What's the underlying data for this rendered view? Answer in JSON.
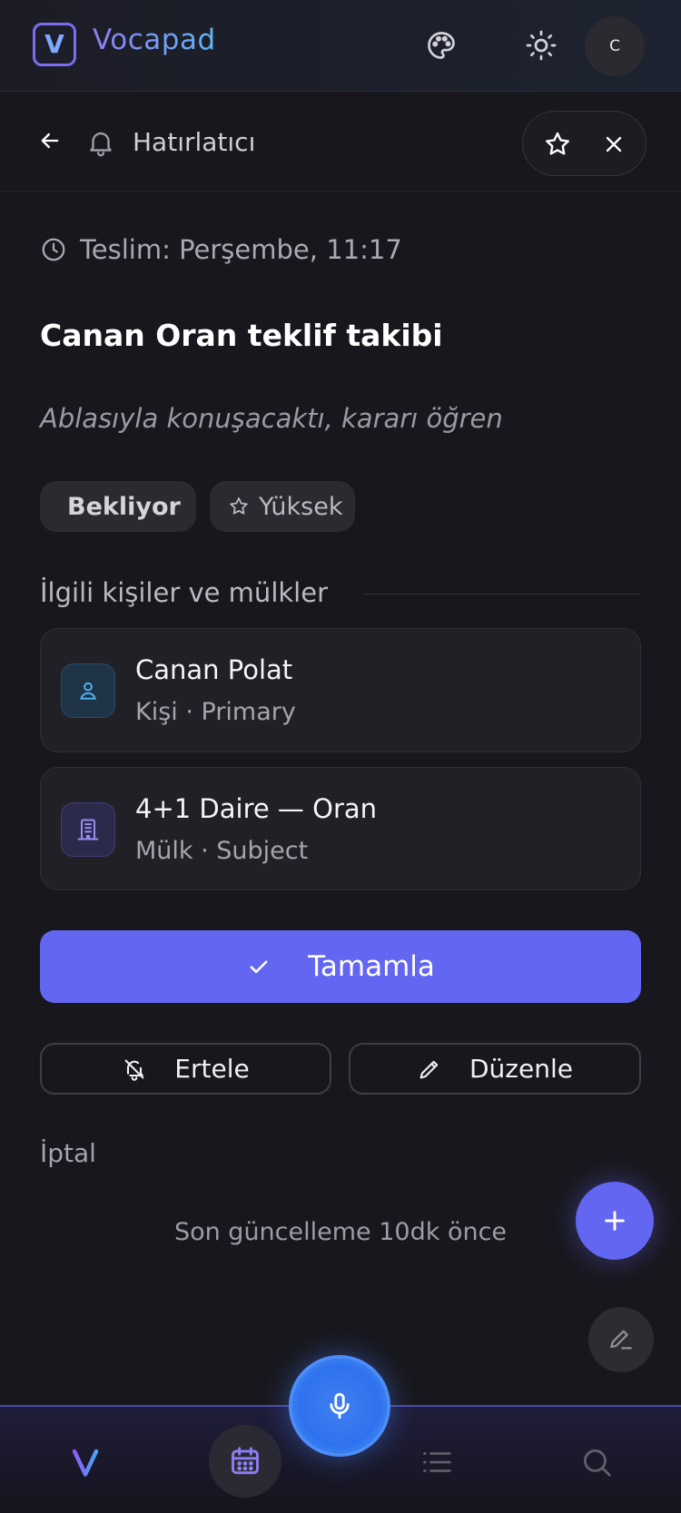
{
  "header": {
    "logo_letter": "V",
    "brand": "Vocapad",
    "avatar_initial": "C",
    "icons": [
      "palette-icon",
      "sun-icon"
    ]
  },
  "subheader": {
    "title": "Hatırlatıcı",
    "icons": [
      "back-arrow-icon",
      "bell-icon",
      "star-icon",
      "close-icon"
    ]
  },
  "reminder": {
    "due": "Teslim: Perşembe, 11:17",
    "title": "Canan Oran teklif takibi",
    "note": "Ablasıyla konuşacaktı, kararı öğren",
    "status": "Bekliyor",
    "priority": "Yüksek"
  },
  "related": {
    "heading": "İlgili kişiler ve mülkler",
    "items": [
      {
        "title": "Canan Polat",
        "subtitle": "Kişi · Primary",
        "icon": "person-icon"
      },
      {
        "title": "4+1 Daire — Oran",
        "subtitle": "Mülk · Subject",
        "icon": "building-icon"
      }
    ]
  },
  "actions": {
    "complete": "Tamamla",
    "postpone": "Ertele",
    "edit": "Düzenle",
    "cancel": "İptal"
  },
  "footer_note": "Son güncelleme 10dk önce",
  "nav": {
    "items": [
      "home-logo",
      "calendar",
      "list",
      "search"
    ],
    "active": "calendar"
  },
  "colors": {
    "accent": "#6366f1",
    "background": "#18171d",
    "status_dot": "#f39b1d",
    "mic": "#3b7cf0"
  }
}
